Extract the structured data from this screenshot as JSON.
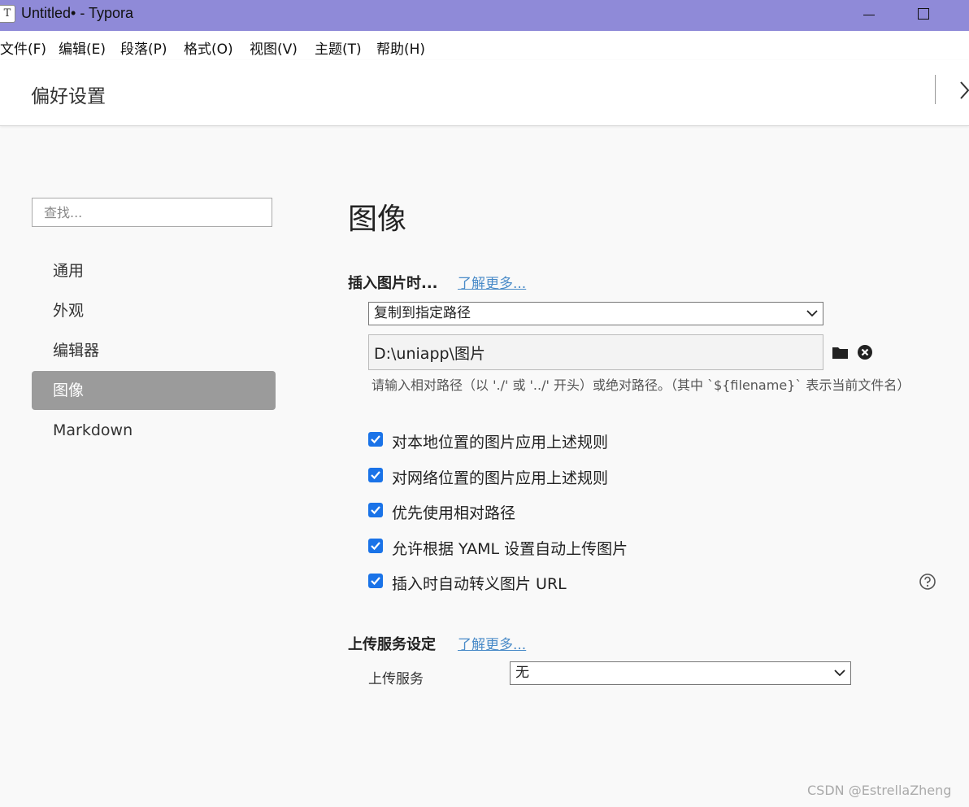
{
  "window": {
    "title": "Untitled• - Typora",
    "app_icon_glyph": "T"
  },
  "menu": {
    "items": [
      "文件(F)",
      "编辑(E)",
      "段落(P)",
      "格式(O)",
      "视图(V)",
      "主题(T)",
      "帮助(H)"
    ]
  },
  "preferences": {
    "title": "偏好设置"
  },
  "sidebar": {
    "search_placeholder": "查找...",
    "items": [
      {
        "label": "通用"
      },
      {
        "label": "外观"
      },
      {
        "label": "编辑器"
      },
      {
        "label": "图像",
        "active": true
      },
      {
        "label": "Markdown"
      }
    ]
  },
  "main": {
    "heading": "图像",
    "insert_group": {
      "title": "插入图片时...",
      "learn_more": "了解更多...",
      "action_select": "复制到指定路径",
      "path_value": "D:\\uniapp\\图片",
      "hint": "请输入相对路径（以 './' 或 '../' 开头）或绝对路径。（其中 `${filename}` 表示当前文件名）",
      "checkboxes": [
        {
          "label": "对本地位置的图片应用上述规则",
          "checked": true
        },
        {
          "label": "对网络位置的图片应用上述规则",
          "checked": true
        },
        {
          "label": "优先使用相对路径",
          "checked": true
        },
        {
          "label": "允许根据 YAML 设置自动上传图片",
          "checked": true
        },
        {
          "label": "插入时自动转义图片 URL",
          "checked": true
        }
      ]
    },
    "upload_group": {
      "title": "上传服务设定",
      "learn_more": "了解更多...",
      "service_label": "上传服务",
      "service_select": "无"
    }
  },
  "watermark": "CSDN @EstrellaZheng",
  "colors": {
    "titlebar": "#8f8ad8",
    "accent_checkbox": "#1a73e8",
    "link": "#4a8bc8",
    "sidebar_active": "#9b9b9b"
  }
}
